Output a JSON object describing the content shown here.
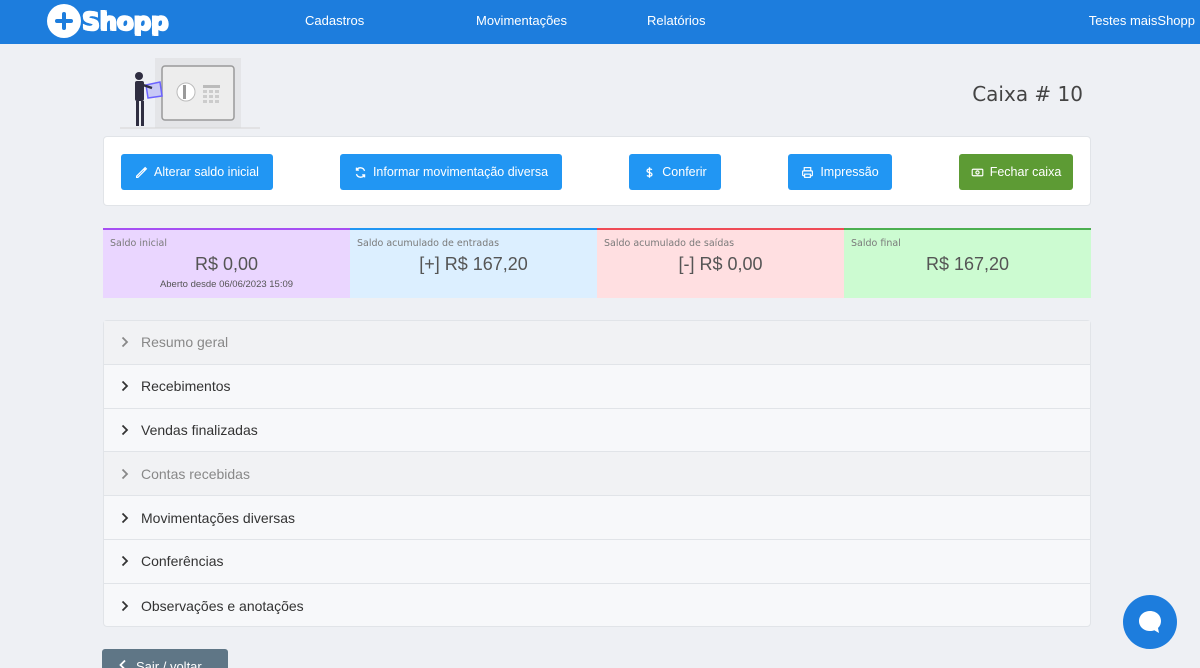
{
  "brand": {
    "logo_text": "Shopp"
  },
  "nav": {
    "items": [
      {
        "label": "Cadastros"
      },
      {
        "label": "Movimentações"
      },
      {
        "label": "Relatórios"
      }
    ],
    "user": "Testes maisShopp"
  },
  "header": {
    "title": "Caixa # 10"
  },
  "actions": {
    "alterar_saldo": "Alterar saldo inicial",
    "informar_mov": "Informar movimentação diversa",
    "conferir": "Conferir",
    "impressao": "Impressão",
    "fechar": "Fechar caixa"
  },
  "stats": [
    {
      "label": "Saldo inicial",
      "value": "R$ 0,00",
      "sub": "Aberto desde 06/06/2023 15:09",
      "color": "#a64ff3",
      "bg": "#ead6ff"
    },
    {
      "label": "Saldo acumulado de entradas",
      "value": "[+] R$ 167,20",
      "color": "#2196f3",
      "bg": "#dcefff"
    },
    {
      "label": "Saldo acumulado de saídas",
      "value": "[-] R$ 0,00",
      "color": "#ef4b56",
      "bg": "#ffdfe1"
    },
    {
      "label": "Saldo final",
      "value": "R$ 167,20",
      "color": "#4caf50",
      "bg": "#ccfbd1"
    }
  ],
  "accordion": [
    {
      "label": "Resumo geral",
      "muted": true
    },
    {
      "label": "Recebimentos",
      "muted": false
    },
    {
      "label": "Vendas finalizadas",
      "muted": false
    },
    {
      "label": "Contas recebidas",
      "muted": true
    },
    {
      "label": "Movimentações diversas",
      "muted": false
    },
    {
      "label": "Conferências",
      "muted": false
    },
    {
      "label": "Observações e anotações",
      "muted": false
    }
  ],
  "back": {
    "label": "Sair / voltar"
  }
}
